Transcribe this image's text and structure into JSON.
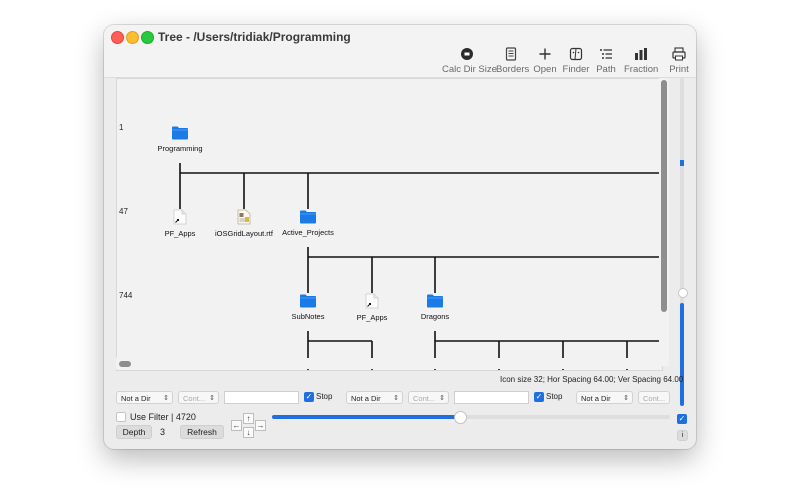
{
  "window": {
    "title": "Tree - /Users/tridiak/Programming"
  },
  "toolbar": {
    "calc_dir_size": "Calc Dir Size",
    "borders": "Borders",
    "open": "Open",
    "finder": "Finder",
    "path": "Path",
    "fraction": "Fraction",
    "print": "Print"
  },
  "tree": {
    "depth_counts": [
      "1",
      "47",
      "744"
    ],
    "nodes": {
      "programming": "Programming",
      "pf_apps_1": "PF_Apps",
      "iosgrid": "iOSGridLayout.rtf",
      "active_projects": "Active_Projects",
      "subnotes": "SubNotes",
      "pf_apps_2": "PF_Apps",
      "dragons": "Dragons"
    }
  },
  "status": "Icon size 32; Hor Spacing 64.00; Ver Spacing 64.00",
  "filters": [
    {
      "type": "Not a Dir",
      "cond": "Cont...",
      "value": "",
      "stop_label": "Stop",
      "stop": true
    },
    {
      "type": "Not a Dir",
      "cond": "Cont...",
      "value": "",
      "stop_label": "Stop",
      "stop": true
    },
    {
      "type": "Not a Dir",
      "cond": "Cont..."
    }
  ],
  "use_filter": {
    "label": "Use Filter",
    "checked": false,
    "count": "| 4720"
  },
  "depth": {
    "button": "Depth",
    "value": "3"
  },
  "refresh": "Refresh",
  "arrows": {
    "up": "↑",
    "down": "↓",
    "left": "←",
    "right": "→"
  },
  "slider": {
    "value": 0.47
  },
  "right_checkbox": true,
  "info_button": "i",
  "colors": {
    "accent": "#1f6fe0",
    "folder": "#1a7ae8"
  }
}
